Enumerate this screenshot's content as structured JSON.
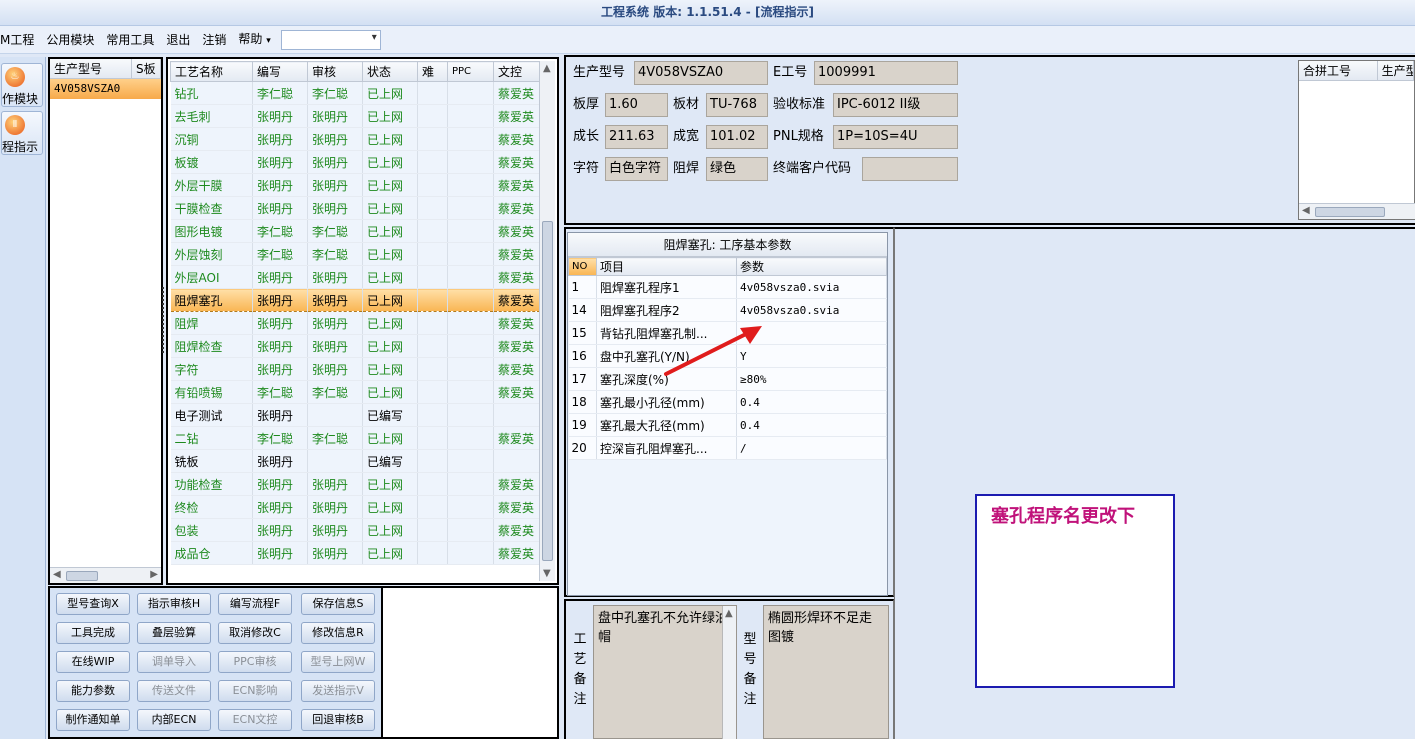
{
  "window": {
    "title": "工程系统   版本: 1.1.51.4 - [流程指示]"
  },
  "menu": [
    "M工程",
    "公用模块",
    "常用工具",
    "退出",
    "注销",
    "帮助"
  ],
  "nav": [
    {
      "label": "作模块"
    },
    {
      "label": "程指示"
    }
  ],
  "model_list": {
    "headers": [
      "生产型号",
      "S板"
    ],
    "rows": [
      "4V058VSZA0"
    ]
  },
  "process_table": {
    "headers": [
      "工艺名称",
      "编写",
      "审核",
      "状态",
      "难",
      "PPC",
      "文控"
    ],
    "rows": [
      [
        "钻孔",
        "李仁聪",
        "李仁聪",
        "已上网",
        "",
        "",
        "蔡爱英"
      ],
      [
        "去毛刺",
        "张明丹",
        "张明丹",
        "已上网",
        "",
        "",
        "蔡爱英"
      ],
      [
        "沉铜",
        "张明丹",
        "张明丹",
        "已上网",
        "",
        "",
        "蔡爱英"
      ],
      [
        "板镀",
        "张明丹",
        "张明丹",
        "已上网",
        "",
        "",
        "蔡爱英"
      ],
      [
        "外层干膜",
        "张明丹",
        "张明丹",
        "已上网",
        "",
        "",
        "蔡爱英"
      ],
      [
        "干膜检查",
        "张明丹",
        "张明丹",
        "已上网",
        "",
        "",
        "蔡爱英"
      ],
      [
        "图形电镀",
        "李仁聪",
        "李仁聪",
        "已上网",
        "",
        "",
        "蔡爱英"
      ],
      [
        "外层蚀刻",
        "李仁聪",
        "李仁聪",
        "已上网",
        "",
        "",
        "蔡爱英"
      ],
      [
        "外层AOI",
        "张明丹",
        "张明丹",
        "已上网",
        "",
        "",
        "蔡爱英"
      ],
      [
        "阻焊塞孔",
        "张明丹",
        "张明丹",
        "已上网",
        "",
        "",
        "蔡爱英"
      ],
      [
        "阻焊",
        "张明丹",
        "张明丹",
        "已上网",
        "",
        "",
        "蔡爱英"
      ],
      [
        "阻焊检查",
        "张明丹",
        "张明丹",
        "已上网",
        "",
        "",
        "蔡爱英"
      ],
      [
        "字符",
        "张明丹",
        "张明丹",
        "已上网",
        "",
        "",
        "蔡爱英"
      ],
      [
        "有铅喷锡",
        "李仁聪",
        "李仁聪",
        "已上网",
        "",
        "",
        "蔡爱英"
      ],
      [
        "电子测试",
        "张明丹",
        "",
        "已编写",
        "",
        "",
        ""
      ],
      [
        "二钻",
        "李仁聪",
        "李仁聪",
        "已上网",
        "",
        "",
        "蔡爱英"
      ],
      [
        "铣板",
        "张明丹",
        "",
        "已编写",
        "",
        "",
        ""
      ],
      [
        "功能检查",
        "张明丹",
        "张明丹",
        "已上网",
        "",
        "",
        "蔡爱英"
      ],
      [
        "终检",
        "张明丹",
        "张明丹",
        "已上网",
        "",
        "",
        "蔡爱英"
      ],
      [
        "包装",
        "张明丹",
        "张明丹",
        "已上网",
        "",
        "",
        "蔡爱英"
      ],
      [
        "成品仓",
        "张明丹",
        "张明丹",
        "已上网",
        "",
        "",
        "蔡爱英"
      ]
    ],
    "selected_index": 9
  },
  "buttons": [
    [
      "型号查询X",
      "指示审核H",
      "编写流程F",
      "保存信息S"
    ],
    [
      "工具完成",
      "叠层验算",
      "取消修改C",
      "修改信息R"
    ],
    [
      "在线WIP",
      "调单导入",
      "PPC审核",
      "型号上网W"
    ],
    [
      "能力参数",
      "传送文件",
      "ECN影响",
      "发送指示V"
    ],
    [
      "制作通知单",
      "内部ECN",
      "ECN文控",
      "回退审核B"
    ]
  ],
  "info": {
    "model_label": "生产型号",
    "model_value": "4V058VSZA0",
    "eno_label": "E工号",
    "eno_value": "1009991",
    "thick_label": "板厚",
    "thick_value": "1.60",
    "material_label": "板材",
    "material_value": "TU-768",
    "std_label": "验收标准",
    "std_value": "IPC-6012 II级",
    "len_label": "成长",
    "len_value": "211.63",
    "wid_label": "成宽",
    "wid_value": "101.02",
    "pnl_label": "PNL规格",
    "pnl_value": "1P=10S=4U",
    "char_label": "字符",
    "char_value": "白色字符",
    "mask_label": "阻焊",
    "mask_value": "绿色",
    "cust_label": "终端客户代码",
    "cust_value": ""
  },
  "merge_grid": {
    "headers": [
      "合拼工号",
      "生产型"
    ]
  },
  "param_grid": {
    "title": "阻焊塞孔: 工序基本参数",
    "headers": [
      "NO",
      "项目",
      "参数"
    ],
    "rows": [
      [
        "1",
        "阻焊塞孔程序1",
        "4v058vsza0.svia"
      ],
      [
        "14",
        "阻焊塞孔程序2",
        "4v058vsza0.svia"
      ],
      [
        "15",
        "背钻孔阻焊塞孔制...",
        ""
      ],
      [
        "16",
        "盘中孔塞孔(Y/N)",
        "Y"
      ],
      [
        "17",
        "塞孔深度(%)",
        "≥80%"
      ],
      [
        "18",
        "塞孔最小孔径(mm)",
        "0.4"
      ],
      [
        "19",
        "塞孔最大孔径(mm)",
        "0.4"
      ],
      [
        "20",
        "控深盲孔阻焊塞孔...",
        "/"
      ]
    ]
  },
  "annotation": {
    "text": "塞孔程序名更改下",
    "arrow_color": "#e01c1c",
    "text_color": "#c0127a",
    "box_color": "#1b1bb0"
  },
  "remarks": {
    "process_label": "工艺备注",
    "process_text": "盘中孔塞孔不允许绿油帽",
    "model_label": "型号备注",
    "model_text": "椭圆形焊环不足走图镀"
  }
}
